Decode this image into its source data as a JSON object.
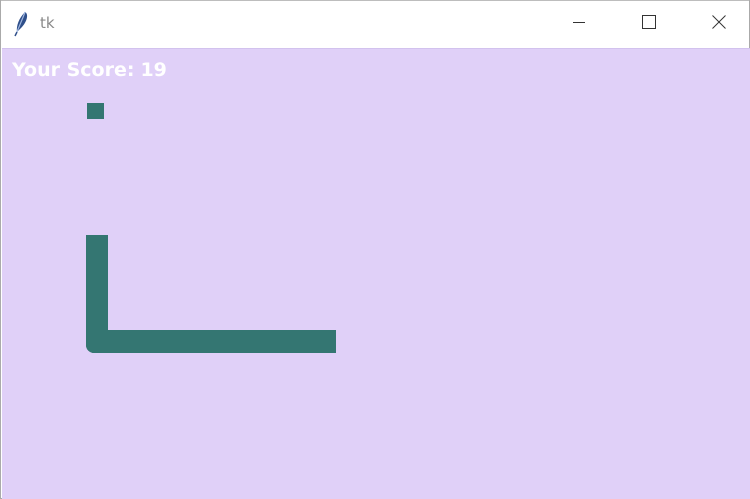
{
  "window": {
    "title": "tk",
    "icons": {
      "app": "feather-icon",
      "minimize": "minimize-icon",
      "maximize": "maximize-icon",
      "close": "close-icon"
    }
  },
  "game": {
    "score_label": "Your Score:",
    "score_value": "19",
    "colors": {
      "background": "#e0d0f8",
      "snake": "#347672",
      "food": "#347672",
      "score_text": "#ffffff"
    }
  }
}
